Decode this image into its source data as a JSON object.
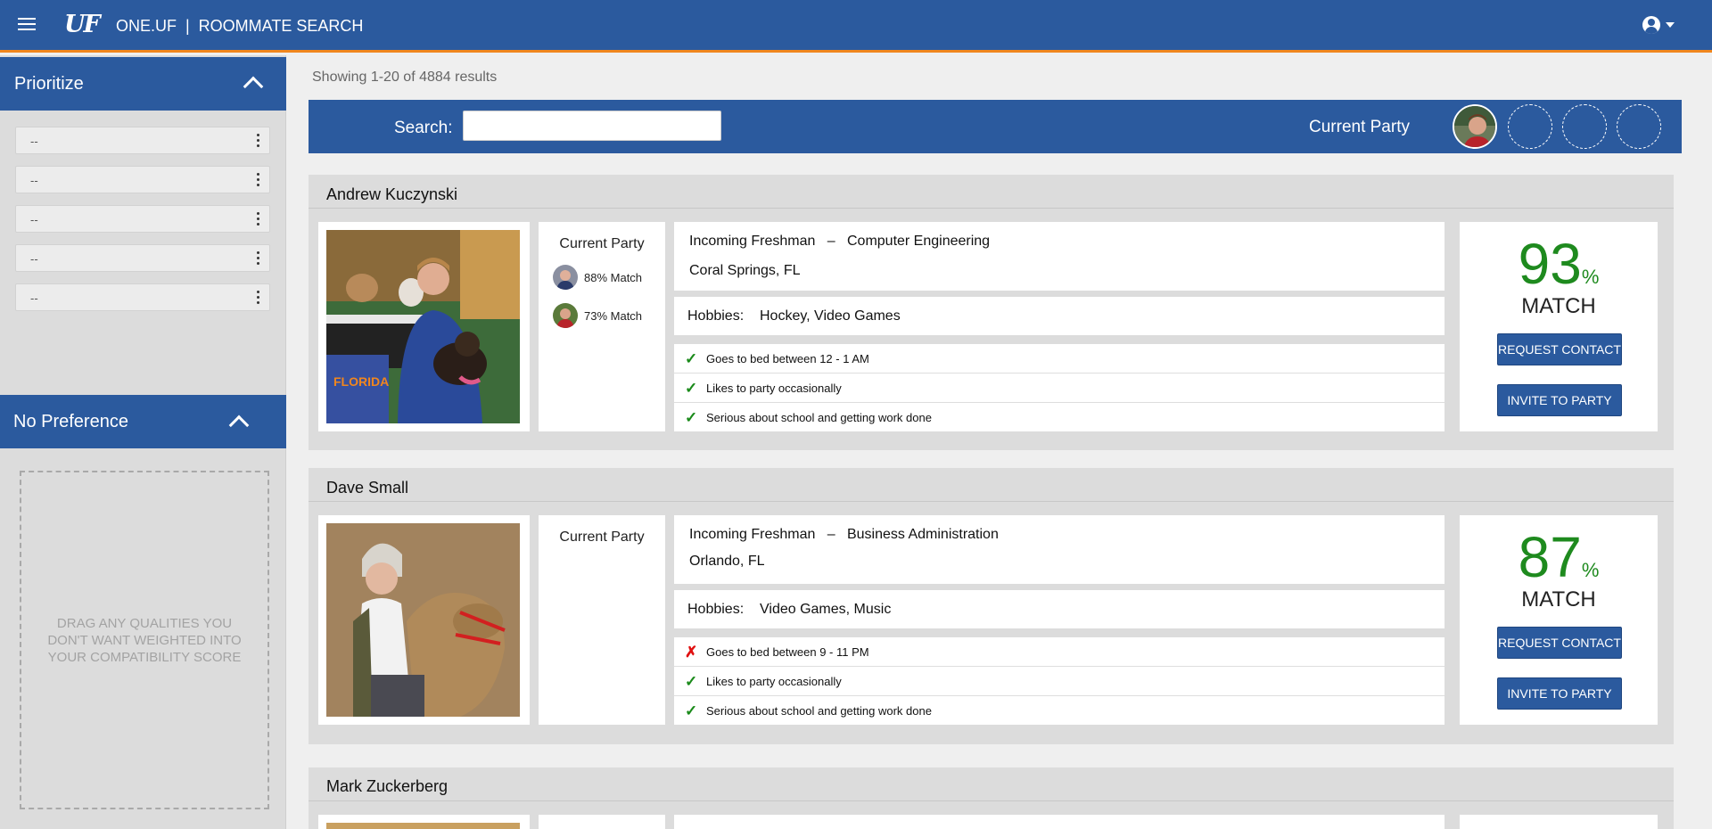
{
  "header": {
    "logo": "UF",
    "title": "ONE.UF  |  ROOMMATE SEARCH"
  },
  "sidebar": {
    "prioritize": {
      "title": "Prioritize",
      "items": [
        "--",
        "--",
        "--",
        "--",
        "--"
      ]
    },
    "no_preference": {
      "title": "No Preference",
      "dropzone_text": "DRAG ANY QUALITIES YOU DON'T WANT WEIGHTED INTO YOUR COMPATIBILITY SCORE"
    }
  },
  "main": {
    "results_text": "Showing 1-20 of 4884 results",
    "search": {
      "label": "Search:",
      "value": "",
      "placeholder": ""
    },
    "current_party_label": "Current Party",
    "match_word": "MATCH",
    "percent_symbol": "%",
    "request_contact_label": "REQUEST CONTACT",
    "invite_label": "INVITE TO PARTY",
    "results": [
      {
        "name": "Andrew Kuczynski",
        "standing": "Incoming Freshman",
        "major": "Computer Engineering",
        "location": "Coral Springs, FL",
        "hobbies_label": "Hobbies:",
        "hobbies": "Hockey, Video Games",
        "party_matches": [
          "88% Match",
          "73% Match"
        ],
        "traits": [
          {
            "text": "Goes to bed between 12 - 1 AM",
            "match": "✓"
          },
          {
            "text": "Likes to party occasionally",
            "match": "✓"
          },
          {
            "text": "Serious about school and getting work done",
            "match": "✓"
          }
        ],
        "match_pct": "93"
      },
      {
        "name": "Dave Small",
        "standing": "Incoming Freshman",
        "major": "Business Administration",
        "location": "Orlando, FL",
        "hobbies_label": "Hobbies:",
        "hobbies": "Video Games, Music",
        "party_matches": [],
        "traits": [
          {
            "text": "Goes to bed between 9 - 11 PM",
            "match": "✗"
          },
          {
            "text": "Likes to party occasionally",
            "match": "✓"
          },
          {
            "text": "Serious about school and getting work done",
            "match": "✓"
          }
        ],
        "match_pct": "87"
      },
      {
        "name": "Mark Zuckerberg"
      }
    ]
  }
}
